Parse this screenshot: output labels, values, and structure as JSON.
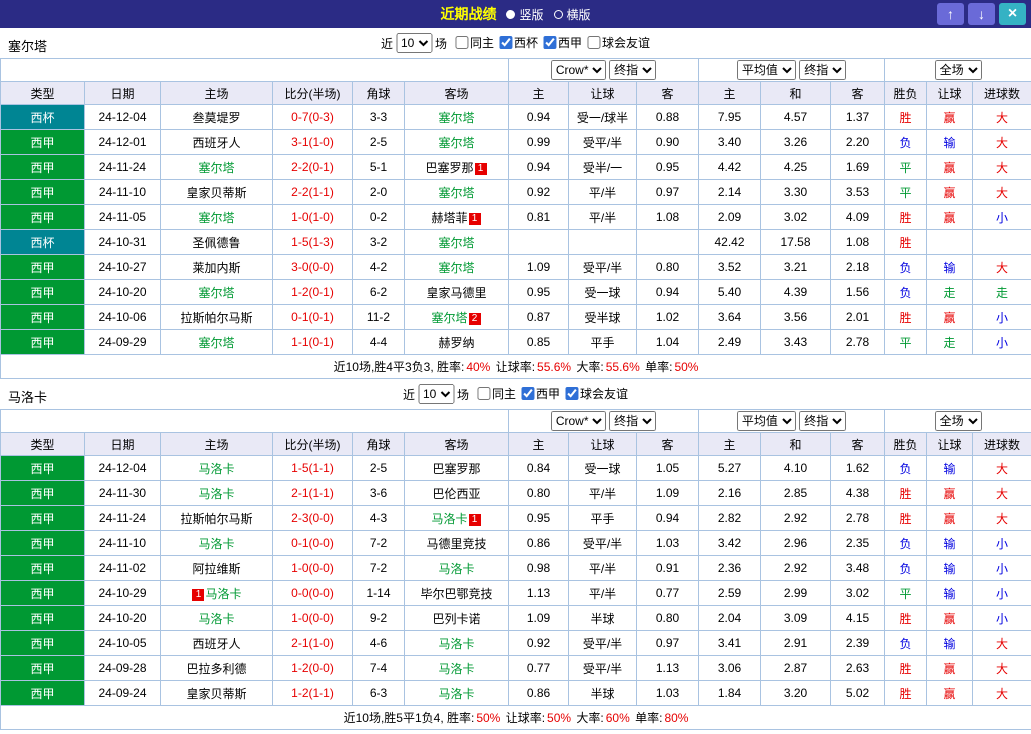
{
  "header": {
    "title": "近期战绩",
    "radio_vertical": "竖版",
    "radio_horizontal": "横版",
    "selected_layout": "竖版",
    "up_icon": "↑",
    "down_icon": "↓",
    "close_icon": "×"
  },
  "controls": {
    "near_label": "近",
    "count_value": "10",
    "matches_label": "场",
    "odds_source": "Crow*",
    "odds_stage1": "终指",
    "avg_label": "平均值",
    "odds_stage2": "终指",
    "scope": "全场"
  },
  "columns": [
    "类型",
    "日期",
    "主场",
    "比分(半场)",
    "角球",
    "客场",
    "主",
    "让球",
    "客",
    "主",
    "和",
    "客",
    "胜负",
    "让球",
    "进球数"
  ],
  "palette": {
    "titlebar_bg": "#2b2b85",
    "header_row_bg": "#e9e9f6",
    "grid_border": "#a9c3e1",
    "focus_team": "#009933",
    "score_red": "#e60000"
  },
  "type_colors": {
    "西甲": "#009933",
    "西杯": "#008593"
  },
  "result_colors": {
    "胜": "#e60000",
    "赢": "#e60000",
    "大": "#e60000",
    "负": "#0000e0",
    "输": "#0000e0",
    "小": "#0000e0",
    "平": "#009933",
    "走": "#009933"
  },
  "sections": [
    {
      "team": "塞尔塔",
      "filters": [
        {
          "label": "同主",
          "checked": false
        },
        {
          "label": "西杯",
          "checked": true
        },
        {
          "label": "西甲",
          "checked": true
        },
        {
          "label": "球会友谊",
          "checked": false
        }
      ],
      "rows": [
        {
          "type": "西杯",
          "date": "24-12-04",
          "home": {
            "name": "叁莫堤罗",
            "focus": false
          },
          "score": "0-7(0-3)",
          "corner": "3-3",
          "away": {
            "name": "塞尔塔",
            "focus": true
          },
          "odds": [
            "0.94",
            "受一/球半",
            "0.88"
          ],
          "avg": [
            "7.95",
            "4.57",
            "1.37"
          ],
          "results": [
            "胜",
            "赢",
            "大"
          ]
        },
        {
          "type": "西甲",
          "date": "24-12-01",
          "home": {
            "name": "西班牙人",
            "focus": false
          },
          "score": "3-1(1-0)",
          "corner": "2-5",
          "away": {
            "name": "塞尔塔",
            "focus": true
          },
          "odds": [
            "0.99",
            "受平/半",
            "0.90"
          ],
          "avg": [
            "3.40",
            "3.26",
            "2.20"
          ],
          "results": [
            "负",
            "输",
            "大"
          ]
        },
        {
          "type": "西甲",
          "date": "24-11-24",
          "home": {
            "name": "塞尔塔",
            "focus": true
          },
          "score": "2-2(0-1)",
          "corner": "5-1",
          "away": {
            "name": "巴塞罗那",
            "focus": false,
            "badge": "1"
          },
          "odds": [
            "0.94",
            "受半/一",
            "0.95"
          ],
          "avg": [
            "4.42",
            "4.25",
            "1.69"
          ],
          "results": [
            "平",
            "赢",
            "大"
          ]
        },
        {
          "type": "西甲",
          "date": "24-11-10",
          "home": {
            "name": "皇家贝蒂斯",
            "focus": false
          },
          "score": "2-2(1-1)",
          "corner": "2-0",
          "away": {
            "name": "塞尔塔",
            "focus": true
          },
          "odds": [
            "0.92",
            "平/半",
            "0.97"
          ],
          "avg": [
            "2.14",
            "3.30",
            "3.53"
          ],
          "results": [
            "平",
            "赢",
            "大"
          ]
        },
        {
          "type": "西甲",
          "date": "24-11-05",
          "home": {
            "name": "塞尔塔",
            "focus": true
          },
          "score": "1-0(1-0)",
          "corner": "0-2",
          "away": {
            "name": "赫塔菲",
            "focus": false,
            "badge": "1"
          },
          "odds": [
            "0.81",
            "平/半",
            "1.08"
          ],
          "avg": [
            "2.09",
            "3.02",
            "4.09"
          ],
          "results": [
            "胜",
            "赢",
            "小"
          ]
        },
        {
          "type": "西杯",
          "date": "24-10-31",
          "home": {
            "name": "圣佩德鲁",
            "focus": false
          },
          "score": "1-5(1-3)",
          "corner": "3-2",
          "away": {
            "name": "塞尔塔",
            "focus": true
          },
          "odds": [
            "",
            "",
            ""
          ],
          "avg": [
            "42.42",
            "17.58",
            "1.08"
          ],
          "results": [
            "胜",
            "",
            ""
          ]
        },
        {
          "type": "西甲",
          "date": "24-10-27",
          "home": {
            "name": "莱加内斯",
            "focus": false
          },
          "score": "3-0(0-0)",
          "corner": "4-2",
          "away": {
            "name": "塞尔塔",
            "focus": true
          },
          "odds": [
            "1.09",
            "受平/半",
            "0.80"
          ],
          "avg": [
            "3.52",
            "3.21",
            "2.18"
          ],
          "results": [
            "负",
            "输",
            "大"
          ]
        },
        {
          "type": "西甲",
          "date": "24-10-20",
          "home": {
            "name": "塞尔塔",
            "focus": true
          },
          "score": "1-2(0-1)",
          "corner": "6-2",
          "away": {
            "name": "皇家马德里",
            "focus": false
          },
          "odds": [
            "0.95",
            "受一球",
            "0.94"
          ],
          "avg": [
            "5.40",
            "4.39",
            "1.56"
          ],
          "results": [
            "负",
            "走",
            "走"
          ]
        },
        {
          "type": "西甲",
          "date": "24-10-06",
          "home": {
            "name": "拉斯帕尔马斯",
            "focus": false
          },
          "score": "0-1(0-1)",
          "corner": "11-2",
          "away": {
            "name": "塞尔塔",
            "focus": true,
            "badge": "2"
          },
          "odds": [
            "0.87",
            "受半球",
            "1.02"
          ],
          "avg": [
            "3.64",
            "3.56",
            "2.01"
          ],
          "results": [
            "胜",
            "赢",
            "小"
          ]
        },
        {
          "type": "西甲",
          "date": "24-09-29",
          "home": {
            "name": "塞尔塔",
            "focus": true
          },
          "score": "1-1(0-1)",
          "corner": "4-4",
          "away": {
            "name": "赫罗纳",
            "focus": false
          },
          "odds": [
            "0.85",
            "平手",
            "1.04"
          ],
          "avg": [
            "2.49",
            "3.43",
            "2.78"
          ],
          "results": [
            "平",
            "走",
            "小"
          ]
        }
      ],
      "summary": [
        {
          "t": "近10场,胜4平3负3, 胜率:",
          "red": false
        },
        {
          "t": "40%",
          "red": true
        },
        {
          "t": " 让球率:",
          "red": false
        },
        {
          "t": "55.6%",
          "red": true
        },
        {
          "t": " 大率:",
          "red": false
        },
        {
          "t": "55.6%",
          "red": true
        },
        {
          "t": " 单率:",
          "red": false
        },
        {
          "t": "50%",
          "red": true
        }
      ]
    },
    {
      "team": "马洛卡",
      "filters": [
        {
          "label": "同主",
          "checked": false
        },
        {
          "label": "西甲",
          "checked": true
        },
        {
          "label": "球会友谊",
          "checked": true
        }
      ],
      "rows": [
        {
          "type": "西甲",
          "date": "24-12-04",
          "home": {
            "name": "马洛卡",
            "focus": true
          },
          "score": "1-5(1-1)",
          "corner": "2-5",
          "away": {
            "name": "巴塞罗那",
            "focus": false
          },
          "odds": [
            "0.84",
            "受一球",
            "1.05"
          ],
          "avg": [
            "5.27",
            "4.10",
            "1.62"
          ],
          "results": [
            "负",
            "输",
            "大"
          ]
        },
        {
          "type": "西甲",
          "date": "24-11-30",
          "home": {
            "name": "马洛卡",
            "focus": true
          },
          "score": "2-1(1-1)",
          "corner": "3-6",
          "away": {
            "name": "巴伦西亚",
            "focus": false
          },
          "odds": [
            "0.80",
            "平/半",
            "1.09"
          ],
          "avg": [
            "2.16",
            "2.85",
            "4.38"
          ],
          "results": [
            "胜",
            "赢",
            "大"
          ]
        },
        {
          "type": "西甲",
          "date": "24-11-24",
          "home": {
            "name": "拉斯帕尔马斯",
            "focus": false
          },
          "score": "2-3(0-0)",
          "corner": "4-3",
          "away": {
            "name": "马洛卡",
            "focus": true,
            "badge": "1"
          },
          "odds": [
            "0.95",
            "平手",
            "0.94"
          ],
          "avg": [
            "2.82",
            "2.92",
            "2.78"
          ],
          "results": [
            "胜",
            "赢",
            "大"
          ]
        },
        {
          "type": "西甲",
          "date": "24-11-10",
          "home": {
            "name": "马洛卡",
            "focus": true
          },
          "score": "0-1(0-0)",
          "corner": "7-2",
          "away": {
            "name": "马德里竞技",
            "focus": false
          },
          "odds": [
            "0.86",
            "受平/半",
            "1.03"
          ],
          "avg": [
            "3.42",
            "2.96",
            "2.35"
          ],
          "results": [
            "负",
            "输",
            "小"
          ]
        },
        {
          "type": "西甲",
          "date": "24-11-02",
          "home": {
            "name": "阿拉维斯",
            "focus": false
          },
          "score": "1-0(0-0)",
          "corner": "7-2",
          "away": {
            "name": "马洛卡",
            "focus": true
          },
          "odds": [
            "0.98",
            "平/半",
            "0.91"
          ],
          "avg": [
            "2.36",
            "2.92",
            "3.48"
          ],
          "results": [
            "负",
            "输",
            "小"
          ]
        },
        {
          "type": "西甲",
          "date": "24-10-29",
          "home": {
            "name": "马洛卡",
            "focus": true,
            "badge": "1",
            "badge_pos": "before"
          },
          "score": "0-0(0-0)",
          "corner": "1-14",
          "away": {
            "name": "毕尔巴鄂竞技",
            "focus": false
          },
          "odds": [
            "1.13",
            "平/半",
            "0.77"
          ],
          "avg": [
            "2.59",
            "2.99",
            "3.02"
          ],
          "results": [
            "平",
            "输",
            "小"
          ]
        },
        {
          "type": "西甲",
          "date": "24-10-20",
          "home": {
            "name": "马洛卡",
            "focus": true
          },
          "score": "1-0(0-0)",
          "corner": "9-2",
          "away": {
            "name": "巴列卡诺",
            "focus": false
          },
          "odds": [
            "1.09",
            "半球",
            "0.80"
          ],
          "avg": [
            "2.04",
            "3.09",
            "4.15"
          ],
          "results": [
            "胜",
            "赢",
            "小"
          ]
        },
        {
          "type": "西甲",
          "date": "24-10-05",
          "home": {
            "name": "西班牙人",
            "focus": false
          },
          "score": "2-1(1-0)",
          "corner": "4-6",
          "away": {
            "name": "马洛卡",
            "focus": true
          },
          "odds": [
            "0.92",
            "受平/半",
            "0.97"
          ],
          "avg": [
            "3.41",
            "2.91",
            "2.39"
          ],
          "results": [
            "负",
            "输",
            "大"
          ]
        },
        {
          "type": "西甲",
          "date": "24-09-28",
          "home": {
            "name": "巴拉多利德",
            "focus": false
          },
          "score": "1-2(0-0)",
          "corner": "7-4",
          "away": {
            "name": "马洛卡",
            "focus": true
          },
          "odds": [
            "0.77",
            "受平/半",
            "1.13"
          ],
          "avg": [
            "3.06",
            "2.87",
            "2.63"
          ],
          "results": [
            "胜",
            "赢",
            "大"
          ]
        },
        {
          "type": "西甲",
          "date": "24-09-24",
          "home": {
            "name": "皇家贝蒂斯",
            "focus": false
          },
          "score": "1-2(1-1)",
          "corner": "6-3",
          "away": {
            "name": "马洛卡",
            "focus": true
          },
          "odds": [
            "0.86",
            "半球",
            "1.03"
          ],
          "avg": [
            "1.84",
            "3.20",
            "5.02"
          ],
          "results": [
            "胜",
            "赢",
            "大"
          ]
        }
      ],
      "summary": [
        {
          "t": "近10场,胜5平1负4, 胜率:",
          "red": false
        },
        {
          "t": "50%",
          "red": true
        },
        {
          "t": " 让球率:",
          "red": false
        },
        {
          "t": "50%",
          "red": true
        },
        {
          "t": " 大率:",
          "red": false
        },
        {
          "t": "60%",
          "red": true
        },
        {
          "t": " 单率:",
          "red": false
        },
        {
          "t": "80%",
          "red": true
        }
      ]
    }
  ]
}
